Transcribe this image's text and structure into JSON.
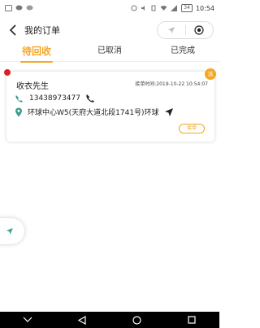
{
  "status_bar": {
    "time": "10:54",
    "battery": "34"
  },
  "header": {
    "title": "我的订单"
  },
  "tabs": [
    {
      "label": "待回收",
      "active": true
    },
    {
      "label": "已取消",
      "active": false
    },
    {
      "label": "已完成",
      "active": false
    }
  ],
  "order": {
    "badge": "派",
    "customer_name": "收衣先生",
    "order_time_label": "接单时间:",
    "order_time": "2019-10-22 10:54:07",
    "order_time_full": "接单时间:2019-10-22 10:54:07",
    "phone": "13438973477",
    "address": "环球中心W5(天府大道北段1741号)环球",
    "accept_label": "接单"
  },
  "colors": {
    "accent": "#f5a623",
    "red_dot": "#e02020"
  },
  "icons": [
    "back-icon",
    "navigate-icon",
    "record-icon",
    "phone-icon",
    "call-icon",
    "location-icon",
    "direction-icon"
  ]
}
